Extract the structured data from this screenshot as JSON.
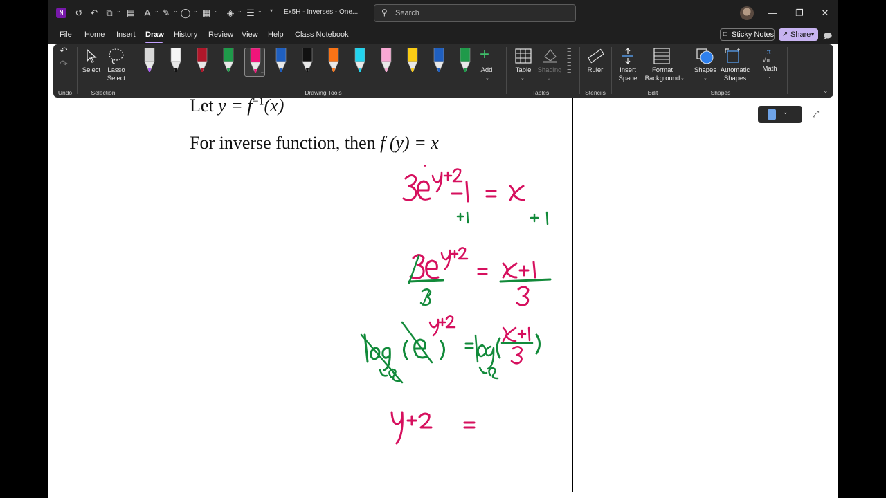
{
  "app": {
    "title": "Ex5H - Inverses - One...",
    "logo_letter": "N",
    "search_placeholder": "Search"
  },
  "window_controls": {
    "minimize": "—",
    "restore": "❐",
    "close": "✕"
  },
  "menu": {
    "tabs": [
      "File",
      "Home",
      "Insert",
      "Draw",
      "History",
      "Review",
      "View",
      "Help",
      "Class Notebook"
    ],
    "active_tab": "Draw",
    "sticky_notes_label": "Sticky Notes",
    "share_label": "Share"
  },
  "ribbon": {
    "groups": {
      "undo": "Undo",
      "selection": "Selection",
      "drawing_tools": "Drawing Tools",
      "tables": "Tables",
      "stencils": "Stencils",
      "edit": "Edit",
      "shapes": "Shapes"
    },
    "buttons": {
      "select": "Select",
      "lasso_line1": "Lasso",
      "lasso_line2": "Select",
      "add": "Add",
      "table": "Table",
      "shading": "Shading",
      "ruler": "Ruler",
      "insert_line1": "Insert",
      "insert_line2": "Space",
      "format_line1": "Format",
      "format_line2": "Background",
      "shapes": "Shapes",
      "automatic_line1": "Automatic",
      "automatic_line2": "Shapes",
      "math": "Math"
    },
    "pens": [
      {
        "name": "pencil-tool",
        "color": "#d8d8d8",
        "tip": "#a855f7"
      },
      {
        "name": "text-pen-tool",
        "color": "#f5f5f5",
        "tip": "#111111"
      },
      {
        "name": "red-pen-tool",
        "color": "#b0172a",
        "tip": "#b0172a"
      },
      {
        "name": "green-pen-tool",
        "color": "#1f9a4a",
        "tip": "#1f9a4a"
      },
      {
        "name": "magenta-pen-tool",
        "color": "#f0157a",
        "tip": "#f0157a"
      },
      {
        "name": "blue-pen-tool",
        "color": "#1f5fbf",
        "tip": "#1f5fbf"
      },
      {
        "name": "black-pen-tool",
        "color": "#111111",
        "tip": "#111111"
      },
      {
        "name": "orange-highlighter-tool",
        "color": "#f97316",
        "tip": "#f97316"
      },
      {
        "name": "cyan-highlighter-tool",
        "color": "#22d3ee",
        "tip": "#22d3ee"
      },
      {
        "name": "pink-highlighter-tool",
        "color": "#f9a8d4",
        "tip": "#f9a8d4"
      },
      {
        "name": "yellow-highlighter-tool",
        "color": "#facc15",
        "tip": "#facc15"
      },
      {
        "name": "blue-fountain-pen-tool",
        "color": "#1f5fbf",
        "tip": "#1f5fbf"
      },
      {
        "name": "green-fountain-pen-tool",
        "color": "#1f9a4a",
        "tip": "#1f9a4a"
      }
    ]
  },
  "page": {
    "line1_prefix": "Let",
    "line1_math": "y = f",
    "line1_sup": "−1",
    "line1_tail": "(x)",
    "line2_prefix": "For inverse function, then",
    "line2_math": "f (y) = x"
  },
  "ink": {
    "magenta": "#d6105e",
    "green": "#128a3a"
  }
}
